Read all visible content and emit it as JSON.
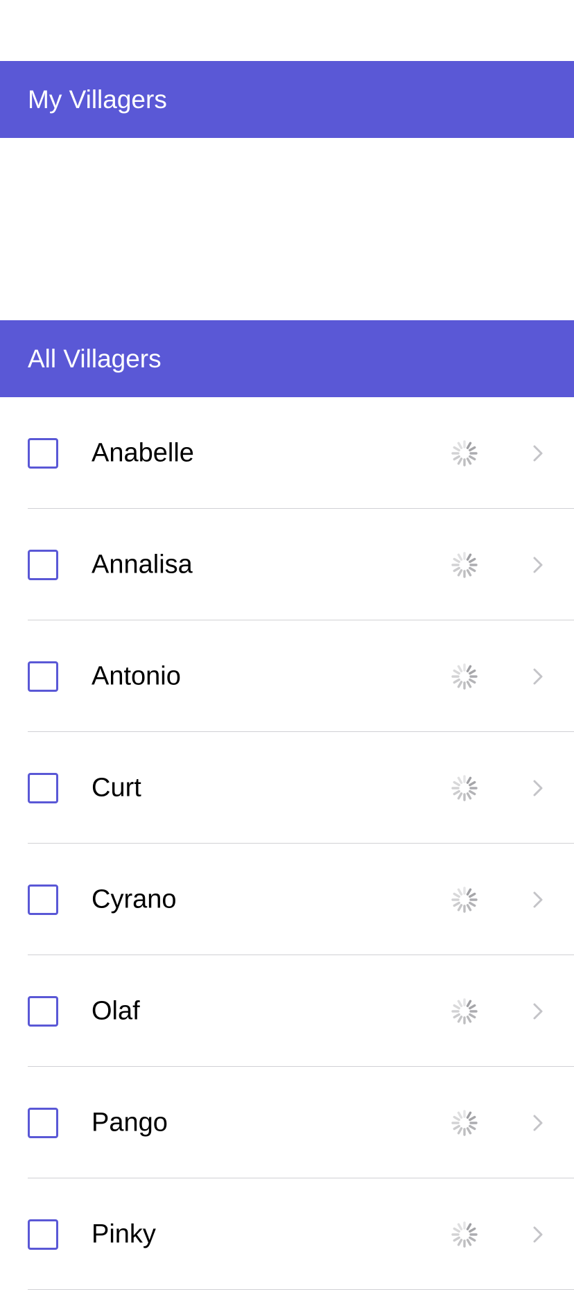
{
  "sections": {
    "my_villagers": {
      "title": "My Villagers"
    },
    "all_villagers": {
      "title": "All Villagers"
    }
  },
  "villagers": [
    {
      "name": "Anabelle",
      "checked": false,
      "icon": "loading-spinner-icon"
    },
    {
      "name": "Annalisa",
      "checked": false,
      "icon": "loading-spinner-icon"
    },
    {
      "name": "Antonio",
      "checked": false,
      "icon": "loading-spinner-icon"
    },
    {
      "name": "Curt",
      "checked": false,
      "icon": "loading-spinner-icon"
    },
    {
      "name": "Cyrano",
      "checked": false,
      "icon": "loading-spinner-icon"
    },
    {
      "name": "Olaf",
      "checked": false,
      "icon": "loading-spinner-icon"
    },
    {
      "name": "Pango",
      "checked": false,
      "icon": "loading-spinner-icon"
    },
    {
      "name": "Pinky",
      "checked": false,
      "icon": "loading-spinner-icon"
    }
  ],
  "colors": {
    "accent": "#5a58d6",
    "separator": "#d0d0d4",
    "chevron": "#c4c4c8",
    "spinner": "#9a9a9e"
  }
}
